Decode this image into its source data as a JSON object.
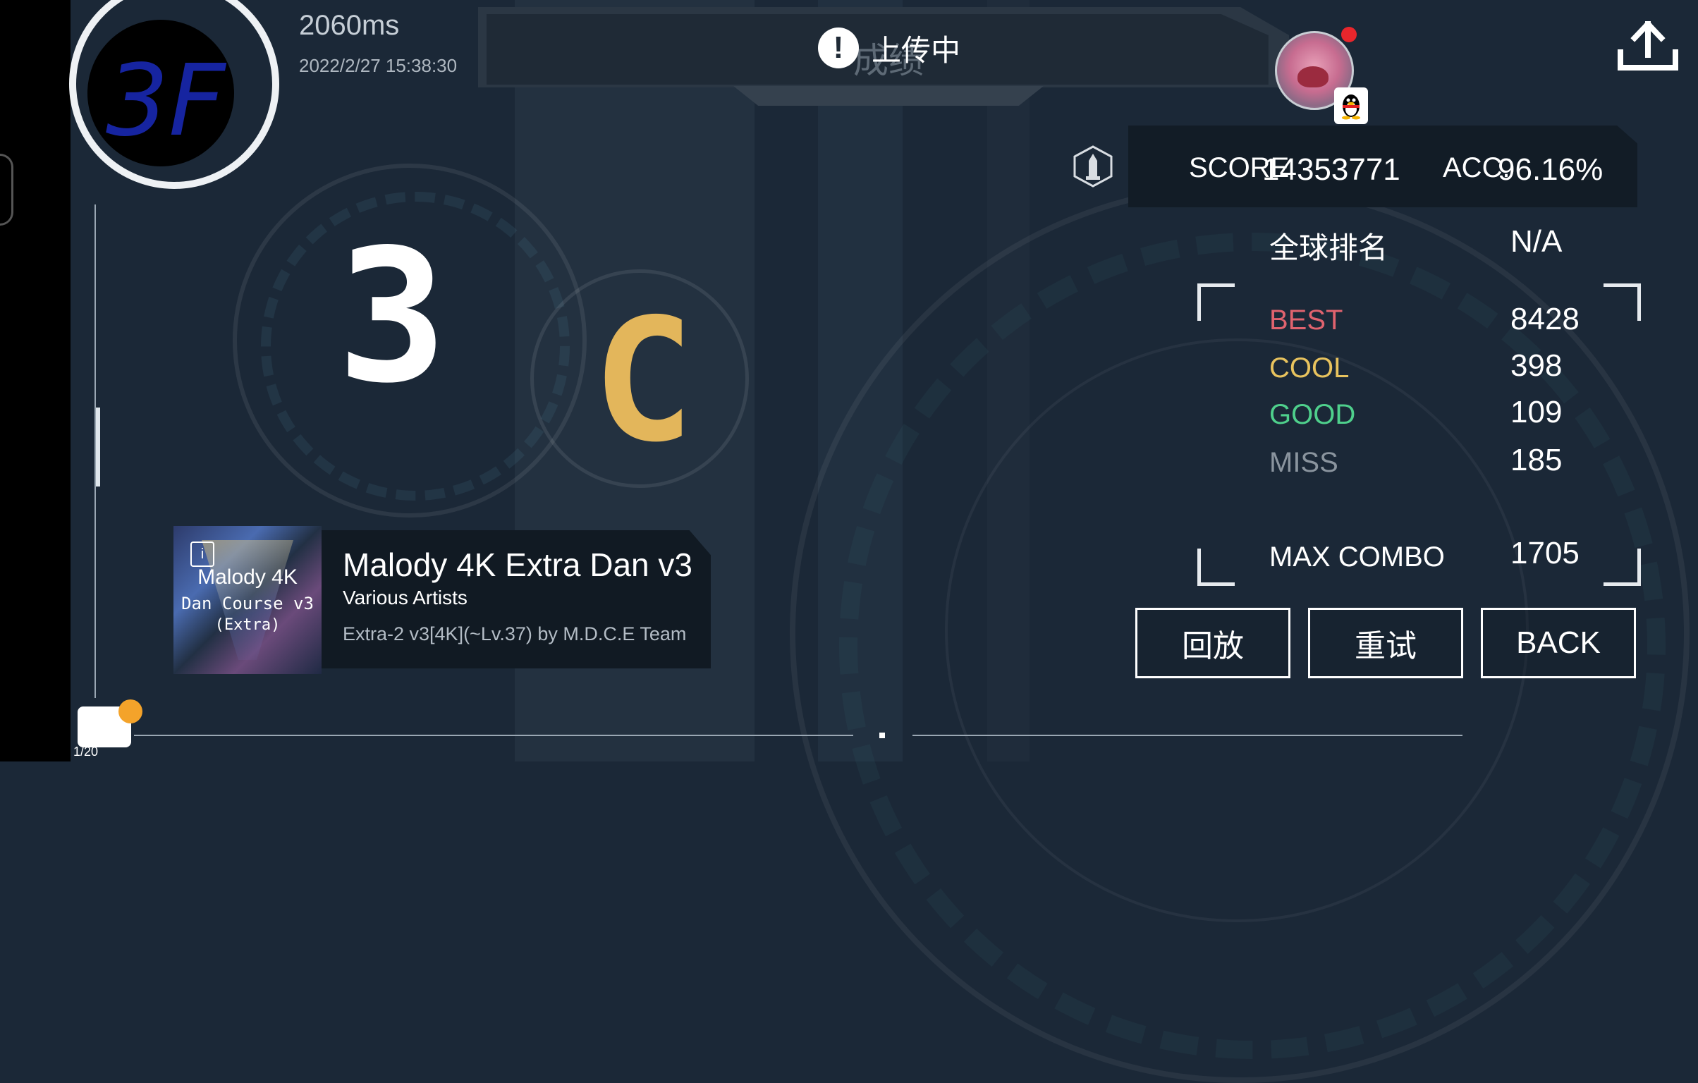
{
  "status": {
    "latency": "2060ms",
    "datetime": "2022/2/27 15:38:30"
  },
  "logo": {
    "text": "3F"
  },
  "banner": {
    "title": "成绩",
    "toast_icon": "!",
    "toast_text": "上传中"
  },
  "user": {
    "avatar_icon": "user-avatar-icon",
    "platform_icon": "qq-penguin-icon"
  },
  "upload_icon": "upload-icon",
  "result": {
    "level": "3",
    "grade": "C",
    "grade_color": "#e3b65b",
    "score_label": "SCORE",
    "score": "14353771",
    "acc_label": "ACC.",
    "acc": "96.16%",
    "global_rank_label": "全球排名",
    "global_rank_value": "N/A",
    "judgements": [
      {
        "label": "BEST",
        "value": "8428",
        "color": "#e0636e"
      },
      {
        "label": "COOL",
        "value": "398",
        "color": "#e8c35e"
      },
      {
        "label": "GOOD",
        "value": "109",
        "color": "#4fd08c"
      },
      {
        "label": "MISS",
        "value": "185",
        "color": "#8a949e"
      }
    ],
    "max_combo_label": "MAX COMBO",
    "max_combo": "1705"
  },
  "buttons": {
    "replay": "回放",
    "retry": "重试",
    "back": "BACK"
  },
  "song": {
    "cover_line1": "Malody 4K",
    "cover_line2": "Dan Course v3",
    "cover_line3": "(Extra)",
    "title": "Malody 4K Extra Dan v3",
    "artist": "Various Artists",
    "chart": "Extra-2 v3[4K](~Lv.37) by M.D.C.E Team"
  },
  "badge": {
    "count": "1/20"
  }
}
